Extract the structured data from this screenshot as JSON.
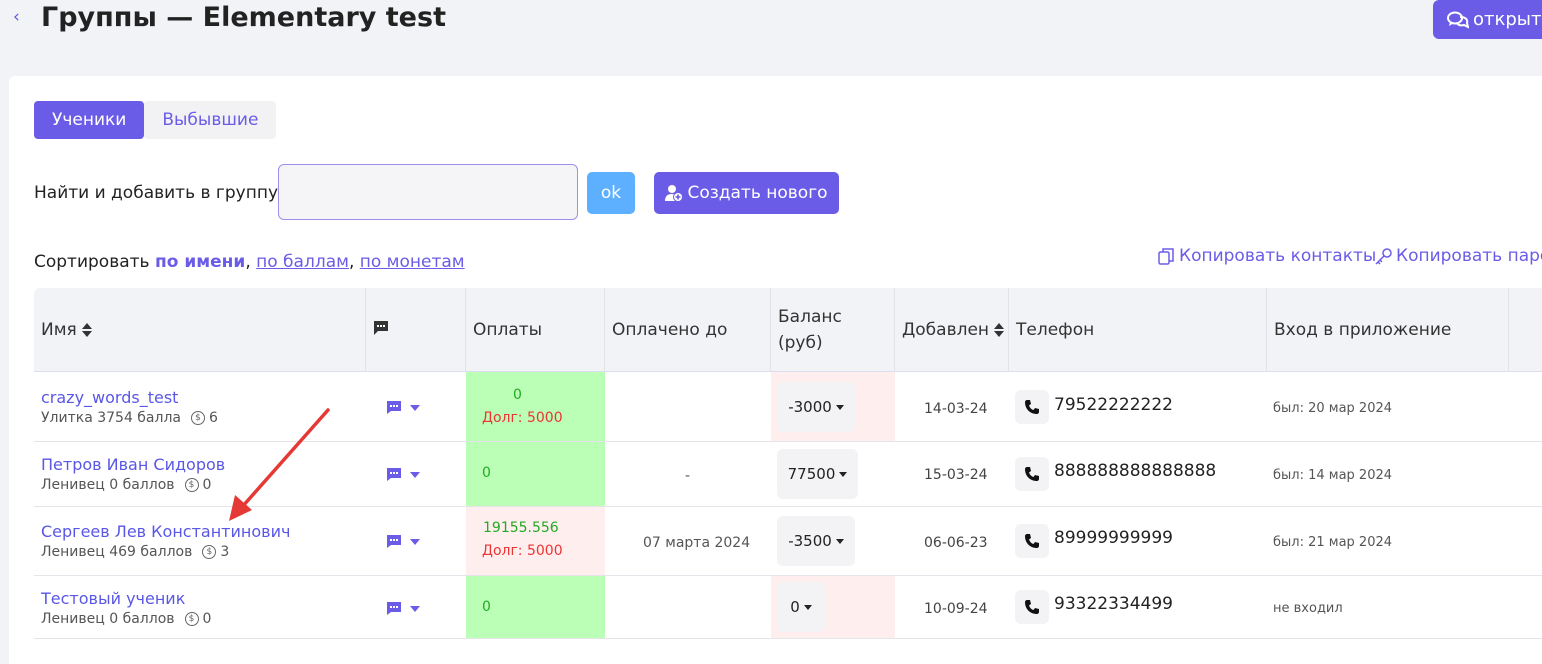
{
  "header": {
    "back_glyph": "‹",
    "title": "Группы — Elementary test",
    "open_button_label": "открыть"
  },
  "tabs": [
    {
      "label": "Ученики",
      "active": true
    },
    {
      "label": "Выбывшие",
      "active": false
    }
  ],
  "add_form": {
    "label": "Найти и добавить в группу:",
    "input_value": "",
    "ok_label": "ok",
    "create_label": "Создать нового"
  },
  "sort": {
    "prefix": "Сортировать",
    "by_name": "по имени",
    "by_points": "по баллам",
    "by_coins": "по монетам",
    "separator": ","
  },
  "actions": {
    "copy_contacts": "Копировать контакты",
    "copy_passwords": "Копировать паро"
  },
  "table": {
    "headers": {
      "name": "Имя",
      "payments": "Оплаты",
      "paid_until": "Оплачено до",
      "balance_line1": "Баланс",
      "balance_line2": "(руб)",
      "added": "Добавлен",
      "phone": "Телефон",
      "app_login": "Вход в приложение"
    },
    "rows": [
      {
        "name": "crazy_words_test",
        "subtitle": "Улитка 3754 балла",
        "coins": "6",
        "payment": "0",
        "debt": "Долг: 5000",
        "paid_until": "",
        "balance": "-3000",
        "added": "14-03-24",
        "phone": "79522222222",
        "last_login": "был: 20 мар 2024",
        "payment_status": "green",
        "balance_status": "pink"
      },
      {
        "name": "Петров Иван Сидоров",
        "subtitle": "Ленивец 0 баллов",
        "coins": "0",
        "payment": "0",
        "debt": "",
        "paid_until": "-",
        "balance": "77500",
        "added": "15-03-24",
        "phone": "888888888888888",
        "last_login": "был: 14 мар 2024",
        "payment_status": "green",
        "balance_status": "none"
      },
      {
        "name": "Сергеев Лев Константинович",
        "subtitle": "Ленивец 469 баллов",
        "coins": "3",
        "payment": "19155.556",
        "debt": "Долг: 5000",
        "paid_until": "07 марта 2024",
        "balance": "-3500",
        "added": "06-06-23",
        "phone": "89999999999",
        "last_login": "был: 21 мар 2024",
        "payment_status": "pink",
        "balance_status": "none"
      },
      {
        "name": "Тестовый ученик",
        "subtitle": "Ленивец 0 баллов",
        "coins": "0",
        "payment": "0",
        "debt": "",
        "paid_until": "",
        "balance": "0",
        "added": "10-09-24",
        "phone": "93322334499",
        "last_login": "не входил",
        "payment_status": "green",
        "balance_status": "pink"
      }
    ]
  },
  "colors": {
    "accent": "#6b5ce7",
    "ok_button": "#5cb0ff",
    "paid_green": "#bbffb6",
    "debt_pink": "#ffeeee",
    "annotation_arrow": "#e53935"
  }
}
